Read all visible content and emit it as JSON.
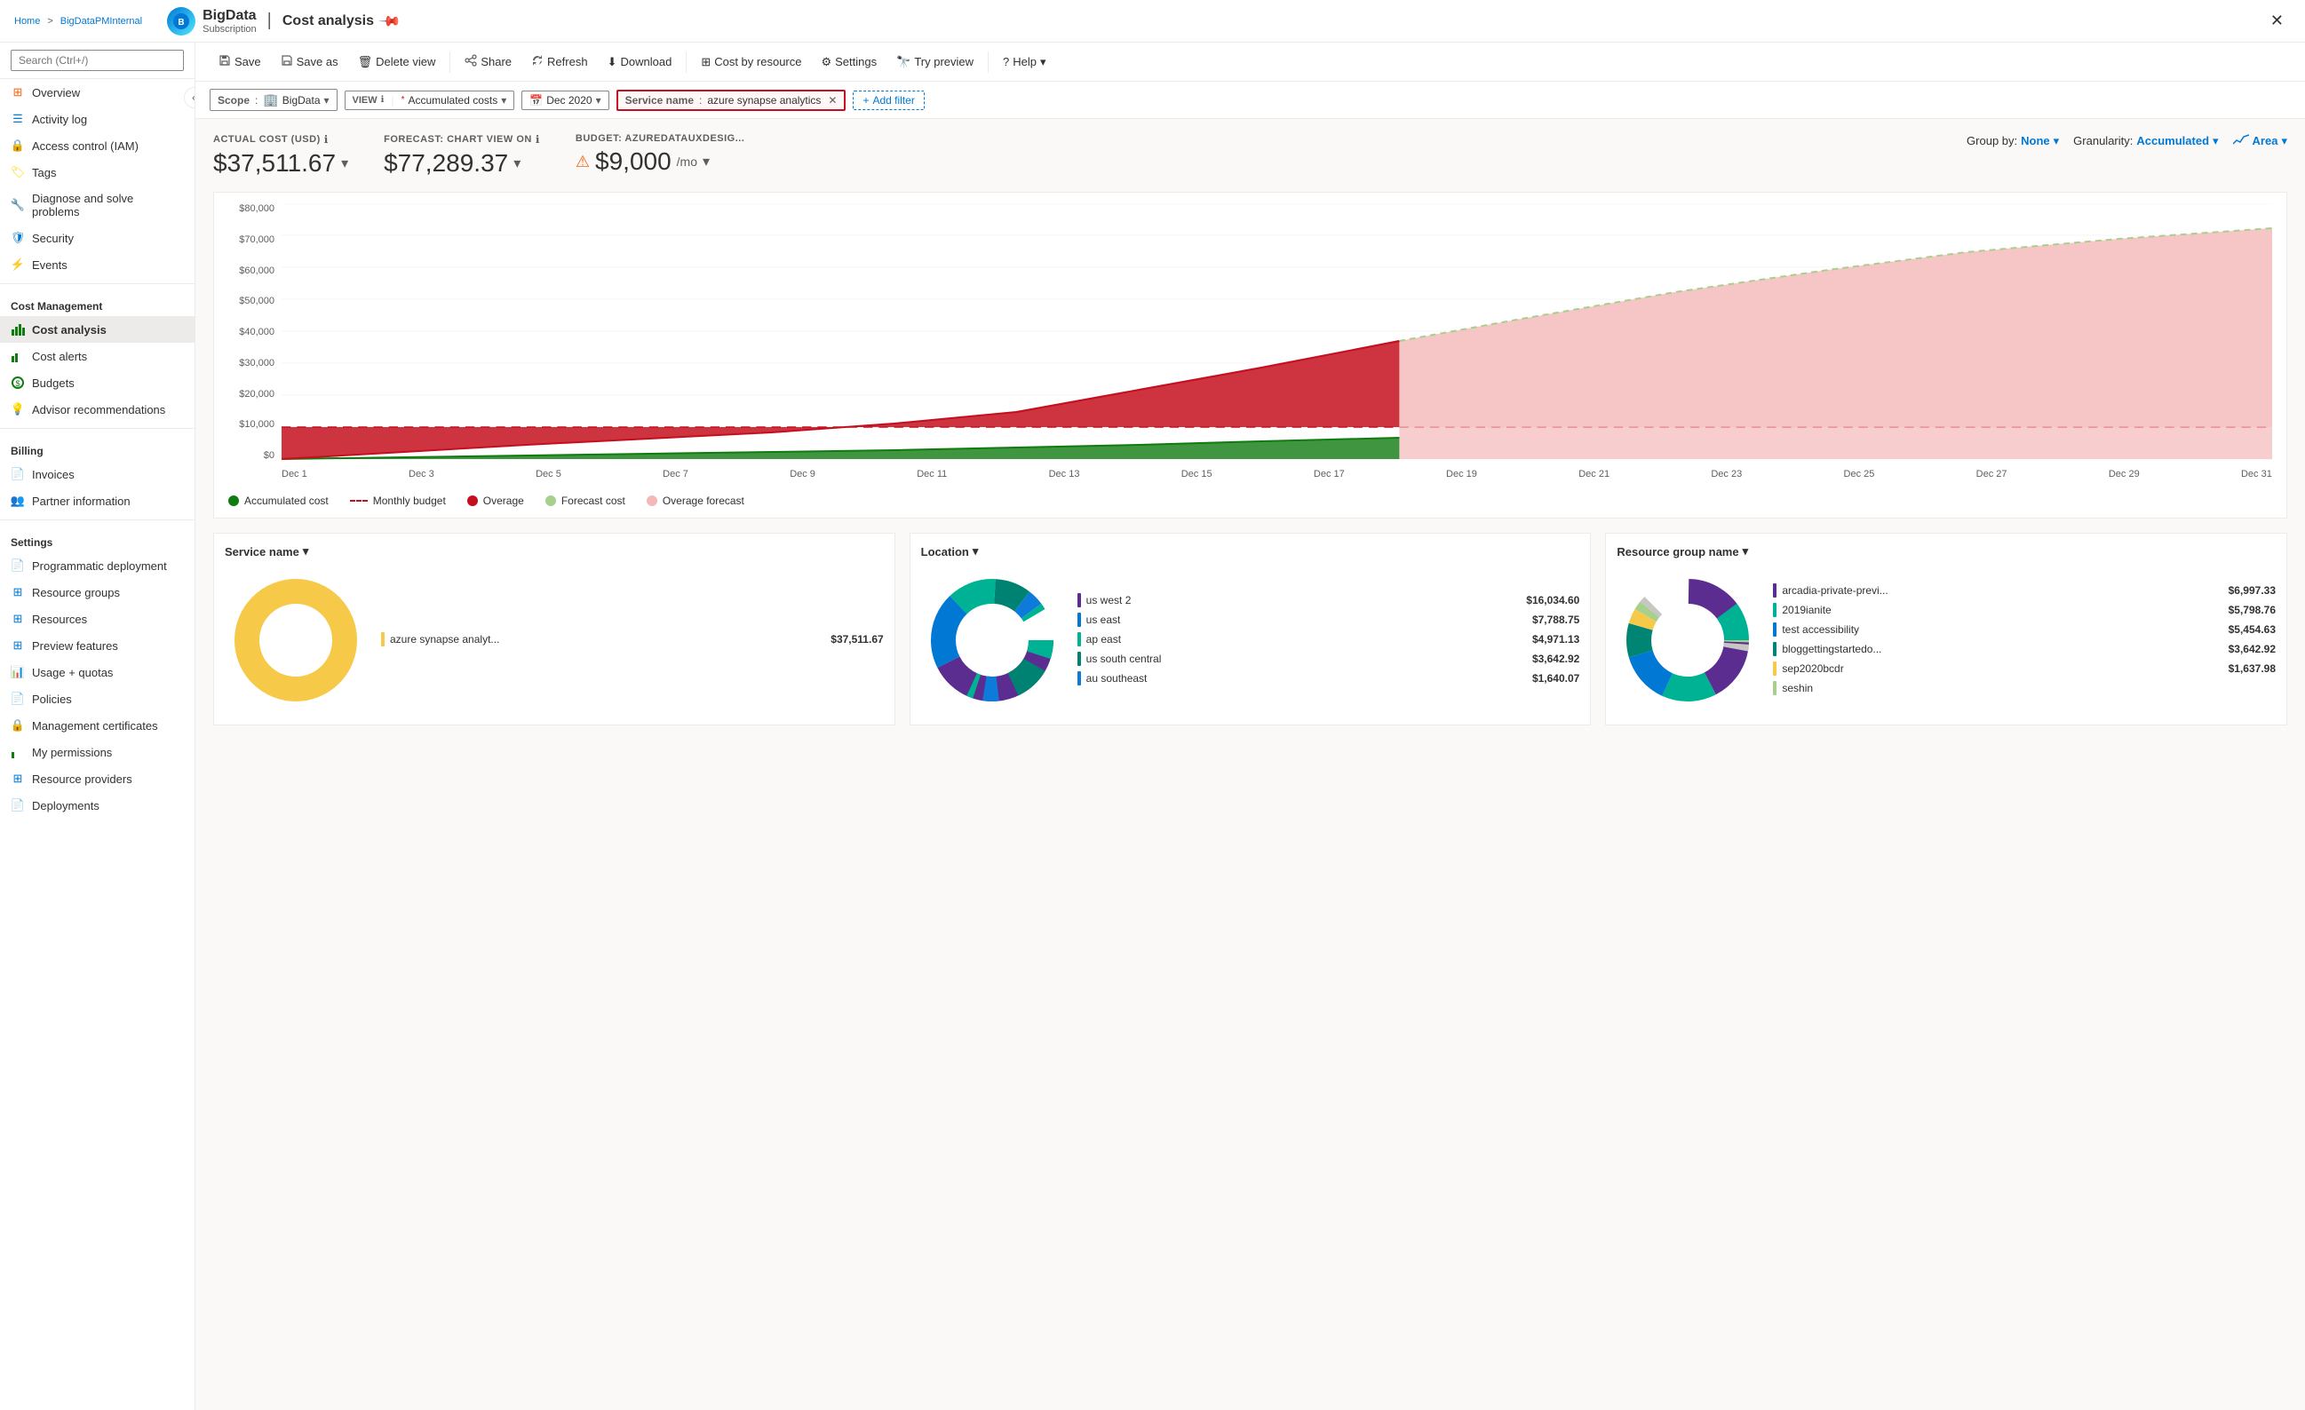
{
  "topbar": {
    "breadcrumb_home": "Home",
    "breadcrumb_separator": ">",
    "breadcrumb_sub": "BigDataPMInternal",
    "app_name": "BigData",
    "app_subtitle": "Subscription",
    "page_title": "Cost analysis",
    "pin_icon": "📌",
    "close_icon": "✕"
  },
  "sidebar": {
    "search_placeholder": "Search (Ctrl+/)",
    "items": [
      {
        "id": "overview",
        "label": "Overview",
        "icon": "⊞",
        "color": "#f7630c"
      },
      {
        "id": "activity-log",
        "label": "Activity log",
        "icon": "☰",
        "color": "#0078d4"
      },
      {
        "id": "access-control",
        "label": "Access control (IAM)",
        "icon": "🔒",
        "color": "#0078d4"
      },
      {
        "id": "tags",
        "label": "Tags",
        "icon": "🏷",
        "color": "#ffd700"
      },
      {
        "id": "diagnose",
        "label": "Diagnose and solve problems",
        "icon": "⚡",
        "color": "#0078d4"
      },
      {
        "id": "security",
        "label": "Security",
        "icon": "🛡",
        "color": "#0078d4"
      },
      {
        "id": "events",
        "label": "Events",
        "icon": "⚡",
        "color": "#f7c948"
      }
    ],
    "cost_management_section": "Cost Management",
    "cost_items": [
      {
        "id": "cost-analysis",
        "label": "Cost analysis",
        "icon": "$",
        "active": true
      },
      {
        "id": "cost-alerts",
        "label": "Cost alerts",
        "icon": "$"
      },
      {
        "id": "budgets",
        "label": "Budgets",
        "icon": "$"
      },
      {
        "id": "advisor",
        "label": "Advisor recommendations",
        "icon": "$"
      }
    ],
    "billing_section": "Billing",
    "billing_items": [
      {
        "id": "invoices",
        "label": "Invoices",
        "icon": "📄"
      },
      {
        "id": "partner-info",
        "label": "Partner information",
        "icon": "👥"
      }
    ],
    "settings_section": "Settings",
    "settings_items": [
      {
        "id": "programmatic",
        "label": "Programmatic deployment",
        "icon": "📄"
      },
      {
        "id": "resource-groups",
        "label": "Resource groups",
        "icon": "⊞"
      },
      {
        "id": "resources",
        "label": "Resources",
        "icon": "⊞"
      },
      {
        "id": "preview-features",
        "label": "Preview features",
        "icon": "⊞"
      },
      {
        "id": "usage-quotas",
        "label": "Usage + quotas",
        "icon": "📊"
      },
      {
        "id": "policies",
        "label": "Policies",
        "icon": "📄"
      },
      {
        "id": "mgmt-certs",
        "label": "Management certificates",
        "icon": "🔒"
      },
      {
        "id": "my-permissions",
        "label": "My permissions",
        "icon": "$"
      },
      {
        "id": "resource-providers",
        "label": "Resource providers",
        "icon": "⊞"
      },
      {
        "id": "deployments",
        "label": "Deployments",
        "icon": "📄"
      }
    ]
  },
  "toolbar": {
    "save_label": "Save",
    "save_as_label": "Save as",
    "delete_view_label": "Delete view",
    "share_label": "Share",
    "refresh_label": "Refresh",
    "download_label": "Download",
    "cost_by_resource_label": "Cost by resource",
    "settings_label": "Settings",
    "try_preview_label": "Try preview",
    "help_label": "Help"
  },
  "filters": {
    "scope_label": "Scope",
    "scope_value": "BigData",
    "view_label": "VIEW",
    "view_value": "Accumulated costs",
    "date_value": "Dec 2020",
    "service_filter_label": "Service name",
    "service_filter_value": "azure synapse analytics",
    "add_filter_label": "Add filter"
  },
  "stats": {
    "actual_cost_label": "ACTUAL COST (USD)",
    "actual_cost_value": "$37,511.67",
    "forecast_label": "FORECAST: CHART VIEW ON",
    "forecast_value": "$77,289.37",
    "budget_label": "BUDGET: AZUREDATAUXDESIG...",
    "budget_value": "$9,000",
    "budget_suffix": "/mo",
    "group_by_label": "Group by:",
    "group_by_value": "None",
    "granularity_label": "Granularity:",
    "granularity_value": "Accumulated",
    "area_label": "Area"
  },
  "chart": {
    "y_labels": [
      "$80,000",
      "$70,000",
      "$60,000",
      "$50,000",
      "$40,000",
      "$30,000",
      "$20,000",
      "$10,000",
      "$0"
    ],
    "x_labels": [
      "Dec 1",
      "Dec 3",
      "Dec 5",
      "Dec 7",
      "Dec 9",
      "Dec 11",
      "Dec 13",
      "Dec 15",
      "Dec 17",
      "Dec 19",
      "Dec 21",
      "Dec 23",
      "Dec 25",
      "Dec 27",
      "Dec 29",
      "Dec 31"
    ],
    "legend": [
      {
        "type": "dot",
        "color": "#107c10",
        "label": "Accumulated cost"
      },
      {
        "type": "dashed",
        "color": "#c50f1f",
        "label": "Monthly budget"
      },
      {
        "type": "dot",
        "color": "#c50f1f",
        "label": "Overage"
      },
      {
        "type": "dot",
        "color": "#a8d08d",
        "label": "Forecast cost"
      },
      {
        "type": "dot",
        "color": "#f4b8b8",
        "label": "Overage forecast"
      }
    ]
  },
  "donuts": [
    {
      "title": "Service name",
      "items": [
        {
          "label": "azure synapse analyt...",
          "value": "$37,511.67",
          "color": "#f7c948"
        }
      ],
      "main_color": "#f7c948"
    },
    {
      "title": "Location",
      "items": [
        {
          "label": "us west 2",
          "value": "$16,034.60",
          "color": "#5c2d91"
        },
        {
          "label": "us east",
          "value": "$7,788.75",
          "color": "#0078d4"
        },
        {
          "label": "ap east",
          "value": "$4,971.13",
          "color": "#00b294"
        },
        {
          "label": "us south central",
          "value": "$3,642.92",
          "color": "#008272"
        },
        {
          "label": "au southeast",
          "value": "$1,640.07",
          "color": "#0e7bda"
        }
      ],
      "colors": [
        "#5c2d91",
        "#0078d4",
        "#00b294",
        "#008272",
        "#0e7bda",
        "#68217a",
        "#00188f"
      ]
    },
    {
      "title": "Resource group name",
      "items": [
        {
          "label": "arcadia-private-previ...",
          "value": "$6,997.33",
          "color": "#5c2d91"
        },
        {
          "label": "2019ianite",
          "value": "$5,798.76",
          "color": "#00b294"
        },
        {
          "label": "test accessibility",
          "value": "$5,454.63",
          "color": "#0078d4"
        },
        {
          "label": "bloggettingstartedo...",
          "value": "$3,642.92",
          "color": "#008575"
        },
        {
          "label": "sep2020bcdr",
          "value": "$1,637.98",
          "color": "#f7c948"
        },
        {
          "label": "seshin",
          "value": "",
          "color": "#a8d08d"
        }
      ],
      "colors": [
        "#5c2d91",
        "#00b294",
        "#0078d4",
        "#008575",
        "#f7c948",
        "#a8d08d",
        "#c8c6c4"
      ]
    }
  ]
}
